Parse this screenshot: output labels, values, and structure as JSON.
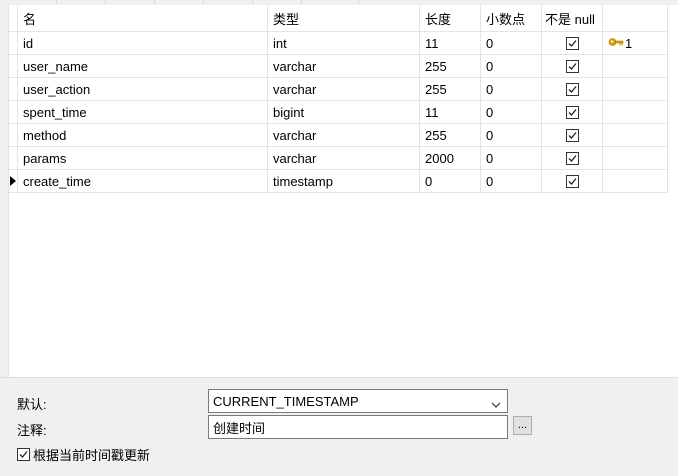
{
  "columns": {
    "name": "名",
    "type": "类型",
    "length": "长度",
    "decimals": "小数点",
    "not_null": "不是 null"
  },
  "rows": [
    {
      "name": "id",
      "type": "int",
      "length": "11",
      "decimals": "0",
      "not_null": true,
      "key": "1"
    },
    {
      "name": "user_name",
      "type": "varchar",
      "length": "255",
      "decimals": "0",
      "not_null": true
    },
    {
      "name": "user_action",
      "type": "varchar",
      "length": "255",
      "decimals": "0",
      "not_null": true
    },
    {
      "name": "spent_time",
      "type": "bigint",
      "length": "11",
      "decimals": "0",
      "not_null": true
    },
    {
      "name": "method",
      "type": "varchar",
      "length": "255",
      "decimals": "0",
      "not_null": true
    },
    {
      "name": "params",
      "type": "varchar",
      "length": "2000",
      "decimals": "0",
      "not_null": true
    },
    {
      "name": "create_time",
      "type": "timestamp",
      "length": "0",
      "decimals": "0",
      "not_null": true,
      "current": true
    }
  ],
  "icons": {
    "primary_key": "key-icon",
    "row_pointer": "row-pointer-icon",
    "dropdown": "chevron-down-icon"
  },
  "colors": {
    "key": "#e0a800"
  },
  "properties": {
    "default_label": "默认:",
    "default_value": "CURRENT_TIMESTAMP",
    "comment_label": "注释:",
    "comment_value": "创建时间",
    "ellipsis_label": "...",
    "update_checkbox_label": "根据当前时间戳更新",
    "update_checked": true
  }
}
